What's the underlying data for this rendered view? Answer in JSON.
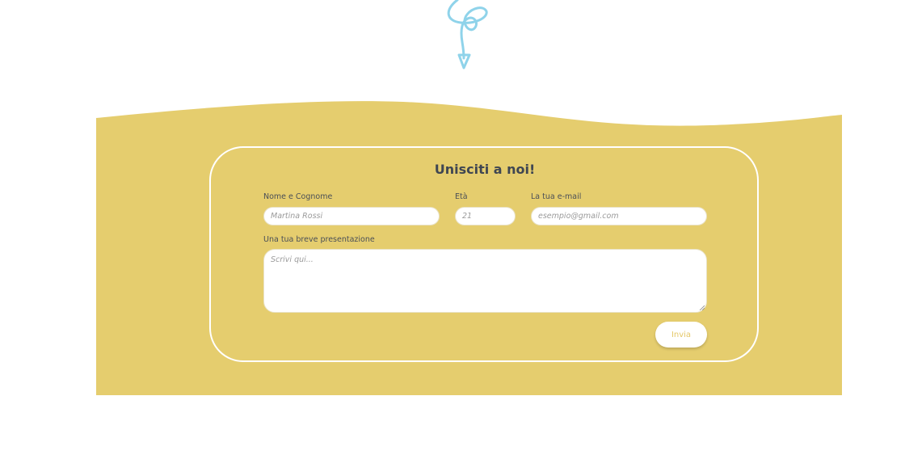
{
  "colors": {
    "band": "#e5cd6e",
    "card_border": "#ffffff",
    "accent_squiggle": "#8fd3ea",
    "title_text": "#3f4652",
    "button_text": "#e5c86a"
  },
  "decor": {
    "top_icon": "arrow-squiggle-icon"
  },
  "form": {
    "title": "Unisciti a noi!",
    "fields": {
      "name": {
        "label": "Nome e Cognome",
        "placeholder": "Martina Rossi"
      },
      "age": {
        "label": "Età",
        "placeholder": "21"
      },
      "email": {
        "label": "La tua e-mail",
        "placeholder": "esempio@gmail.com"
      },
      "bio": {
        "label": "Una tua breve presentazione",
        "placeholder": "Scrivi qui..."
      }
    },
    "submit_label": "Invia"
  }
}
